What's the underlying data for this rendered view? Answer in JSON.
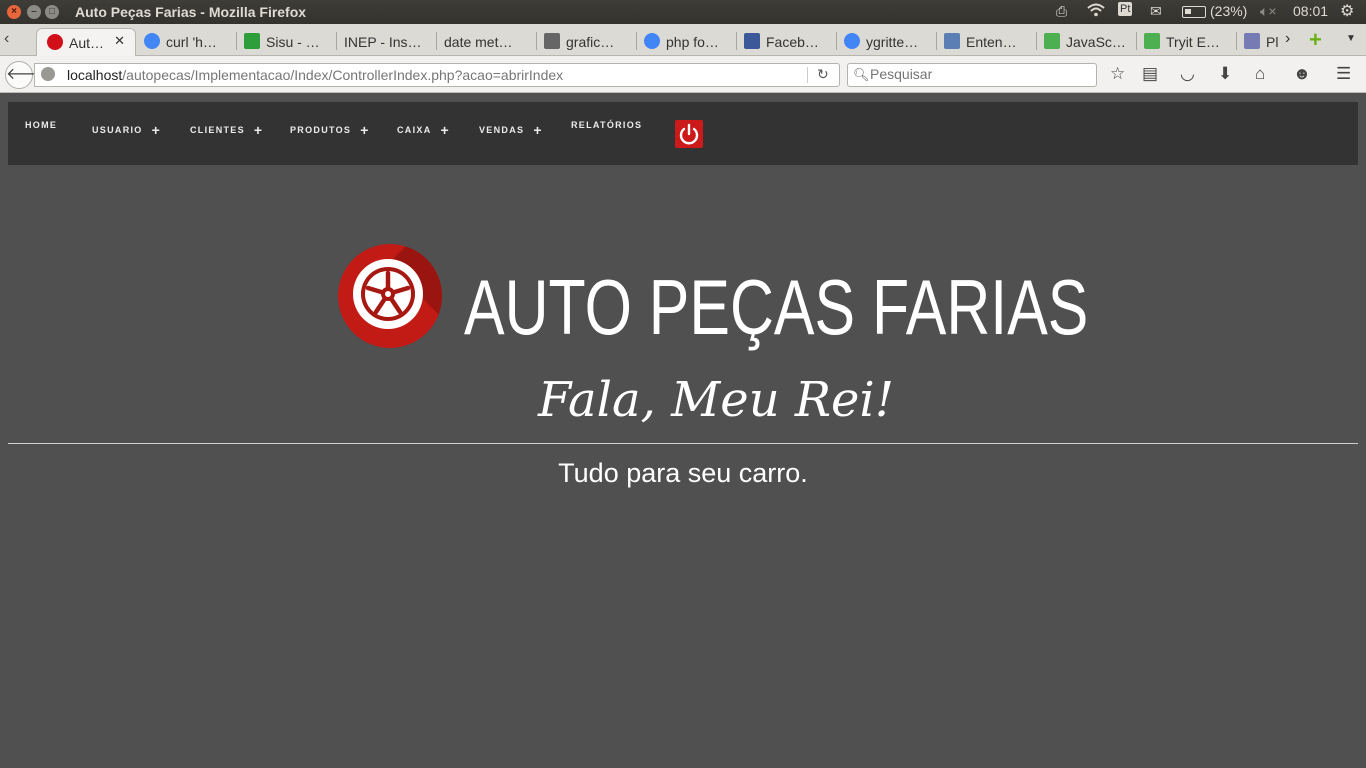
{
  "os": {
    "window_title": "Auto Peças Farias - Mozilla Firefox",
    "battery": "(23%)",
    "clock": "08:01",
    "keyboard_layout": "Pt"
  },
  "tabs": [
    {
      "label": "Aut…",
      "icon": "site-favicon",
      "color": "#d1101a",
      "active": true
    },
    {
      "label": "curl 'h…",
      "icon": "google-icon",
      "color": "#4285f4"
    },
    {
      "label": "Sisu - …",
      "icon": "flag-icon",
      "color": "#2e9e3b"
    },
    {
      "label": "INEP - Ins…",
      "icon": "",
      "color": ""
    },
    {
      "label": "date met…",
      "icon": "",
      "color": ""
    },
    {
      "label": "grafic…",
      "icon": "chart-icon",
      "color": "#666666"
    },
    {
      "label": "php fo…",
      "icon": "google-icon",
      "color": "#4285f4"
    },
    {
      "label": "Faceb…",
      "icon": "facebook-icon",
      "color": "#3b5998"
    },
    {
      "label": "ygritte…",
      "icon": "google-icon",
      "color": "#4285f4"
    },
    {
      "label": "Enten…",
      "icon": "jquery-icon",
      "color": "#5b7fb5"
    },
    {
      "label": "JavaSc…",
      "icon": "w3-icon",
      "color": "#4caf50"
    },
    {
      "label": "Tryit E…",
      "icon": "w3-icon",
      "color": "#4caf50"
    },
    {
      "label": "Pl",
      "icon": "php-icon",
      "color": "#777bb3"
    }
  ],
  "url": {
    "host": "localhost",
    "path": "/autopecas/Implementacao/Index/ControllerIndex.php?acao=abrirIndex"
  },
  "search": {
    "placeholder": "Pesquisar"
  },
  "site_nav": {
    "items": [
      {
        "label": "HOME",
        "has_plus": false
      },
      {
        "label": "USUARIO",
        "has_plus": true
      },
      {
        "label": "CLIENTES",
        "has_plus": true
      },
      {
        "label": "PRODUTOS",
        "has_plus": true
      },
      {
        "label": "CAIXA",
        "has_plus": true
      },
      {
        "label": "VENDAS",
        "has_plus": true
      },
      {
        "label": "RELATÓRIOS",
        "has_plus": false
      }
    ],
    "plus_symbol": "+",
    "power_color": "#cc1a1a"
  },
  "hero": {
    "title": "AUTO PEÇAS FARIAS",
    "slogan": "Fala, Meu Rei!",
    "tagline": "Tudo para seu carro."
  }
}
